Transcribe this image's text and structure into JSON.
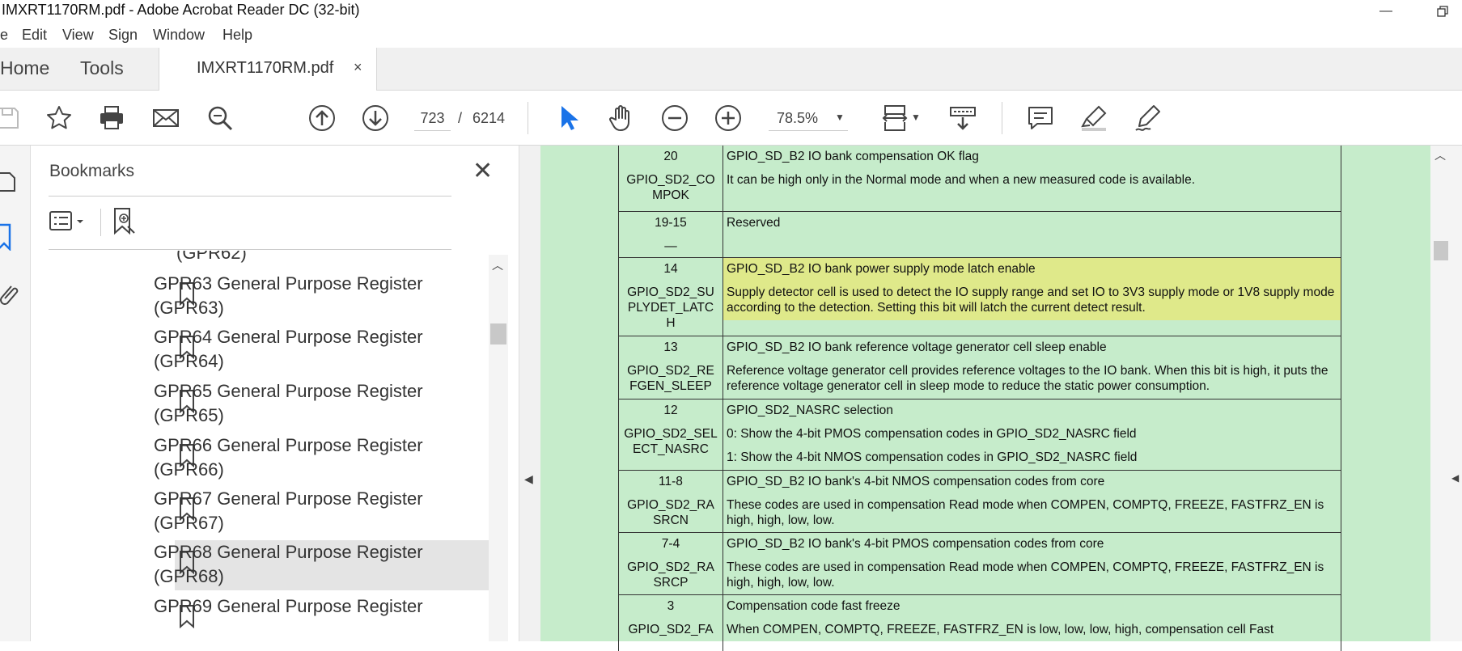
{
  "window": {
    "title": "IMXRT1170RM.pdf - Adobe Acrobat Reader DC (32-bit)"
  },
  "menu": [
    "e",
    "Edit",
    "View",
    "Sign",
    "Window",
    "Help"
  ],
  "tabs": {
    "home": "Home",
    "tools": "Tools",
    "document": "IMXRT1170RM.pdf",
    "close": "×"
  },
  "toolbar": {
    "page_current": "723",
    "page_sep": "/",
    "page_total": "6214",
    "zoom": "78.5%"
  },
  "bookmarks": {
    "title": "Bookmarks",
    "items": [
      {
        "label": "(GPR62)",
        "selected": false,
        "continuation": true
      },
      {
        "label": "GPR63 General Purpose Register (GPR63)",
        "selected": false
      },
      {
        "label": "GPR64 General Purpose Register (GPR64)",
        "selected": false
      },
      {
        "label": "GPR65 General Purpose Register (GPR65)",
        "selected": false
      },
      {
        "label": "GPR66 General Purpose Register (GPR66)",
        "selected": false
      },
      {
        "label": "GPR67 General Purpose Register (GPR67)",
        "selected": false
      },
      {
        "label": "GPR68 General Purpose Register (GPR68)",
        "selected": true
      },
      {
        "label": "GPR69 General Purpose Register",
        "selected": false
      }
    ]
  },
  "register_table": [
    {
      "bits": "20",
      "field": "GPIO_SD2_CO MPOK",
      "title": "GPIO_SD_B2 IO bank compensation OK flag",
      "desc": [
        "It can be high only in the Normal mode and when a new measured code is available."
      ],
      "highlight": false
    },
    {
      "bits": "19-15",
      "field": "—",
      "title": "Reserved",
      "desc": [],
      "highlight": false
    },
    {
      "bits": "14",
      "field": "GPIO_SD2_SU PLYDET_LATC H",
      "title": "GPIO_SD_B2 IO bank power supply mode latch enable",
      "desc": [
        "Supply detector cell is used to detect the IO supply range and set IO to 3V3 supply mode or 1V8 supply mode according to the detection. Setting this bit will latch the current detect result."
      ],
      "highlight": true
    },
    {
      "bits": "13",
      "field": "GPIO_SD2_RE FGEN_SLEEP",
      "title": "GPIO_SD_B2 IO bank reference voltage generator cell sleep enable",
      "desc": [
        "Reference voltage generator cell provides reference voltages to the IO bank. When this bit is high, it puts the reference voltage generator cell in sleep mode to reduce the static power consumption."
      ],
      "highlight": false
    },
    {
      "bits": "12",
      "field": "GPIO_SD2_SEL ECT_NASRC",
      "title": "GPIO_SD2_NASRC selection",
      "desc": [
        "0: Show the 4-bit PMOS compensation codes in GPIO_SD2_NASRC field",
        "1: Show the 4-bit NMOS compensation codes in GPIO_SD2_NASRC field"
      ],
      "highlight": false
    },
    {
      "bits": "11-8",
      "field": "GPIO_SD2_RA SRCN",
      "title": "GPIO_SD_B2 IO bank's 4-bit NMOS compensation codes from core",
      "desc": [
        "These codes are used in compensation Read mode when COMPEN, COMPTQ, FREEZE, FASTFRZ_EN is high, high, low, low."
      ],
      "highlight": false
    },
    {
      "bits": "7-4",
      "field": "GPIO_SD2_RA SRCP",
      "title": "GPIO_SD_B2 IO bank's 4-bit PMOS compensation codes from core",
      "desc": [
        "These codes are used in compensation Read mode when COMPEN, COMPTQ, FREEZE, FASTFRZ_EN is high, high, low, low."
      ],
      "highlight": false
    },
    {
      "bits": "3",
      "field": "GPIO_SD2_FA",
      "title": "Compensation code fast freeze",
      "desc": [
        "When COMPEN, COMPTQ, FREEZE, FASTFRZ_EN is low, low, low, high, compensation cell Fast"
      ],
      "highlight": false
    }
  ],
  "colors": {
    "page_bg": "#c6eccb",
    "highlight": "#dfe98a",
    "accent_blue": "#1a73e8"
  }
}
